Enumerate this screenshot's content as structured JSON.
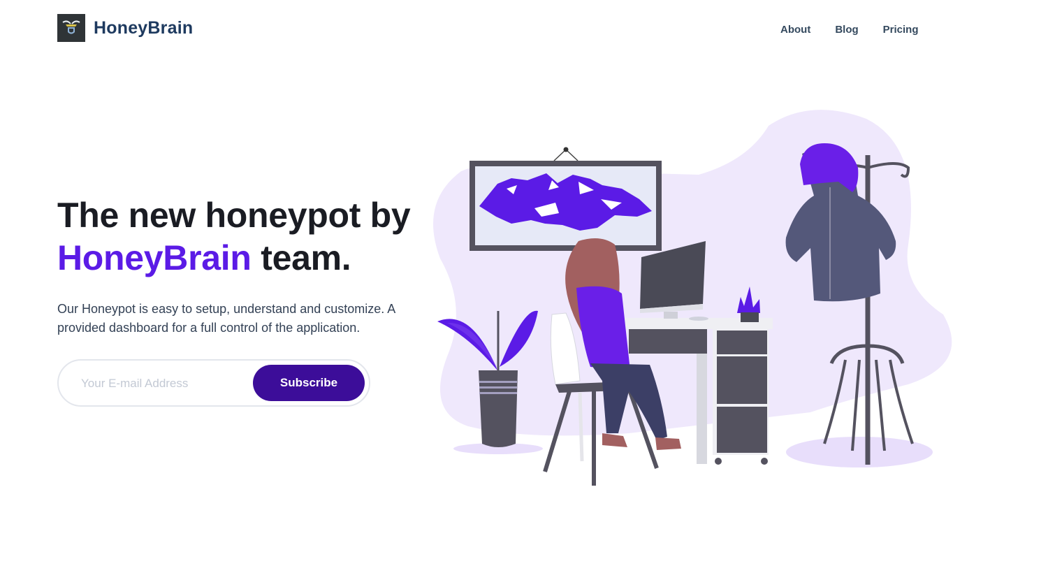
{
  "brand": {
    "name": "HoneyBrain",
    "logo_icon": "bee-shield-icon"
  },
  "nav": {
    "items": [
      "About",
      "Blog",
      "Pricing"
    ]
  },
  "hero": {
    "title_line1": "The new honeypot by",
    "title_accent": "HoneyBrain",
    "title_rest": " team.",
    "description": "Our Honeypot is easy to setup, understand and customize. A provided dashboard for a full control of the application."
  },
  "subscribe": {
    "placeholder": "Your E-mail Address",
    "button_label": "Subscribe"
  },
  "colors": {
    "accent": "#5b1be6",
    "button": "#3c0d99",
    "blob": "#efe8fc",
    "dark": "#555461"
  }
}
